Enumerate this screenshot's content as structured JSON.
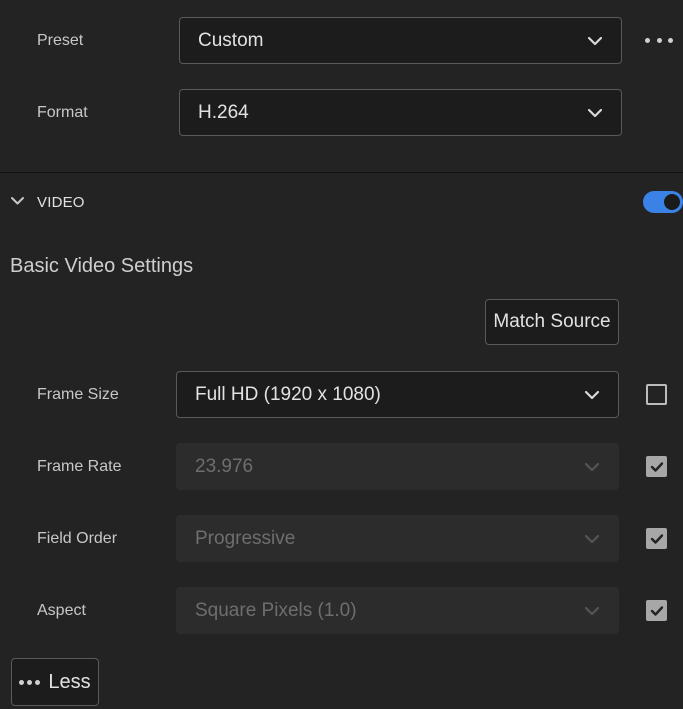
{
  "export": {
    "preset": {
      "label": "Preset",
      "value": "Custom"
    },
    "format": {
      "label": "Format",
      "value": "H.264"
    }
  },
  "more_icon": "more-horizontal-icon",
  "video_section": {
    "title": "VIDEO",
    "enabled": true,
    "toggle_color": "#3b82e6"
  },
  "basic_video": {
    "heading": "Basic Video Settings",
    "match_source_label": "Match Source",
    "frame_size": {
      "label": "Frame Size",
      "value": "Full HD (1920 x 1080)",
      "enabled": true,
      "checked": false
    },
    "frame_rate": {
      "label": "Frame Rate",
      "value": "23.976",
      "enabled": false,
      "checked": true
    },
    "field_order": {
      "label": "Field Order",
      "value": "Progressive",
      "enabled": false,
      "checked": true
    },
    "aspect": {
      "label": "Aspect",
      "value": "Square Pixels (1.0)",
      "enabled": false,
      "checked": true
    }
  },
  "less_button": {
    "label": "Less"
  }
}
